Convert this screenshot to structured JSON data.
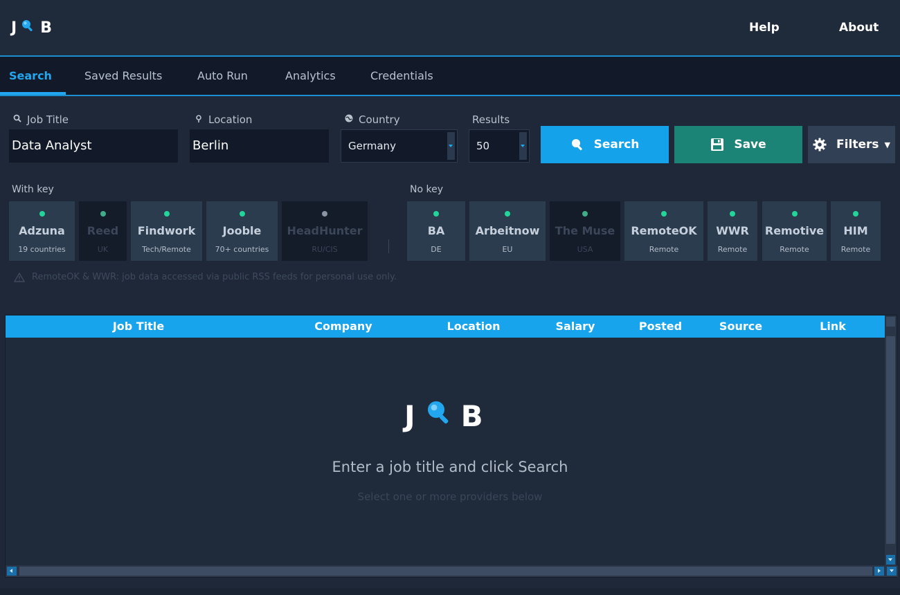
{
  "app": {
    "logo_left": "J",
    "logo_right": "B",
    "accent": "#22a7ee"
  },
  "header": {
    "help": "Help",
    "about": "About"
  },
  "tabs": [
    {
      "label": "Search",
      "active": true
    },
    {
      "label": "Saved Results"
    },
    {
      "label": "Auto Run"
    },
    {
      "label": "Analytics"
    },
    {
      "label": "Credentials"
    }
  ],
  "form": {
    "job_title_label": "Job Title",
    "job_title_value": "Data Analyst",
    "location_label": "Location",
    "location_value": "Berlin",
    "country_label": "Country",
    "country_value": "Germany",
    "results_label": "Results",
    "results_value": "50"
  },
  "buttons": {
    "search": "Search",
    "save": "Save",
    "filters": "Filters"
  },
  "providers": {
    "with_key_label": "With key",
    "no_key_label": "No key",
    "with_key": [
      {
        "name": "Adzuna",
        "sub": "19 countries",
        "enabled": true
      },
      {
        "name": "Reed",
        "sub": "UK",
        "enabled": false
      },
      {
        "name": "Findwork",
        "sub": "Tech/Remote",
        "enabled": true
      },
      {
        "name": "Jooble",
        "sub": "70+ countries",
        "enabled": true
      },
      {
        "name": "HeadHunter",
        "sub": "RU/CIS",
        "enabled": false
      }
    ],
    "no_key": [
      {
        "name": "BA",
        "sub": "DE",
        "enabled": true
      },
      {
        "name": "Arbeitnow",
        "sub": "EU",
        "enabled": true
      },
      {
        "name": "The Muse",
        "sub": "USA",
        "enabled": false
      },
      {
        "name": "RemoteOK",
        "sub": "Remote",
        "enabled": true
      },
      {
        "name": "WWR",
        "sub": "Remote",
        "enabled": true
      },
      {
        "name": "Remotive",
        "sub": "Remote",
        "enabled": true
      },
      {
        "name": "HIM",
        "sub": "Remote",
        "enabled": true
      }
    ],
    "notice": "RemoteOK & WWR: job data accessed via public RSS feeds for personal use only."
  },
  "table": {
    "columns": [
      "Job Title",
      "Company",
      "Location",
      "Salary",
      "Posted",
      "Source",
      "Link"
    ]
  },
  "empty_state": {
    "title": "Enter a job title and click Search",
    "subtitle": "Select one or more providers below"
  }
}
